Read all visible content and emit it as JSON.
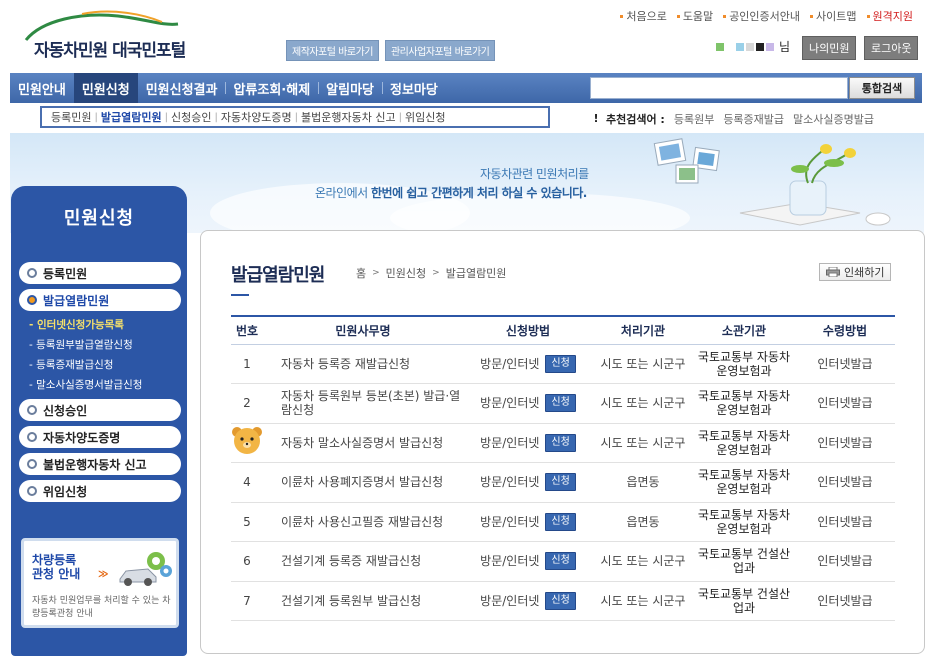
{
  "header": {
    "logo_text": "자동차민원 대국민포털",
    "portal_buttons": [
      "제작자포털 바로가기",
      "관리사업자포털 바로가기"
    ],
    "top_links": [
      "처음으로",
      "도움말",
      "공인인증서안내",
      "사이트맵",
      "원격지원"
    ],
    "user_suffix": "님",
    "my_button": "나의민원",
    "logout_button": "로그아웃"
  },
  "gnb": {
    "items": [
      "민원안내",
      "민원신청",
      "민원신청결과",
      "압류조회·해제",
      "알림마당",
      "정보마당"
    ],
    "active_index": 1,
    "search_value": "",
    "search_button": "통합검색"
  },
  "subnav": {
    "items": [
      "등록민원",
      "발급열람민원",
      "신청승인",
      "자동차양도증명",
      "불법운행자동차 신고",
      "위임신청"
    ],
    "active_index": 1
  },
  "recommend": {
    "label": "추천검색어 :",
    "links": [
      "등록원부",
      "등록증재발급",
      "말소사실증명발급"
    ]
  },
  "banner": {
    "line1": "자동차관련 민원처리를",
    "line2_prefix": "온라인에서 ",
    "line2_bold": "한번에 쉽고 간편하게 처리 하실 수 있습니다."
  },
  "side": {
    "title": "민원신청",
    "menu": [
      {
        "label": "등록민원",
        "active": false
      },
      {
        "label": "발급열람민원",
        "active": true
      }
    ],
    "sub_items": [
      "인터넷신청가능목록",
      "등록원부발급열람신청",
      "등록증재발급신청",
      "말소사실증명서발급신청"
    ],
    "sub_active_index": 0,
    "menu_rest": [
      "신청승인",
      "자동차양도증명",
      "불법운행자동차 신고",
      "위임신청"
    ],
    "box_title_1": "차량등록",
    "box_title_2": "관청 안내",
    "box_arrow": "≫",
    "box_desc": "자동차 민원업무를 처리할 수 있는 차량등록관청 안내"
  },
  "content": {
    "title": "발급열람민원",
    "breadcrumb": [
      "홈",
      "민원신청",
      "발급열람민원"
    ],
    "print_button": "인쇄하기",
    "table": {
      "headers": [
        "번호",
        "민원사무명",
        "신청방법",
        "처리기관",
        "소관기관",
        "수령방법"
      ],
      "apply_label": "신청",
      "rows": [
        {
          "no": "1",
          "name": "자동차 등록증 재발급신청",
          "method": "방문/인터넷",
          "proc": "시도 또는 시군구",
          "org": "국토교통부 자동차운영보험과",
          "recv": "인터넷발급"
        },
        {
          "no": "2",
          "name": "자동차 등록원부 등본(초본) 발급·열람신청",
          "method": "방문/인터넷",
          "proc": "시도 또는 시군구",
          "org": "국토교통부 자동차운영보험과",
          "recv": "인터넷발급"
        },
        {
          "no": "",
          "name": "자동차 말소사실증명서 발급신청",
          "method": "방문/인터넷",
          "proc": "시도 또는 시군구",
          "org": "국토교통부 자동차운영보험과",
          "recv": "인터넷발급"
        },
        {
          "no": "4",
          "name": "이륜차 사용폐지증명서 발급신청",
          "method": "방문/인터넷",
          "proc": "읍면동",
          "org": "국토교통부 자동차운영보험과",
          "recv": "인터넷발급"
        },
        {
          "no": "5",
          "name": "이륜차 사용신고필증 재발급신청",
          "method": "방문/인터넷",
          "proc": "읍면동",
          "org": "국토교통부 자동차운영보험과",
          "recv": "인터넷발급"
        },
        {
          "no": "6",
          "name": "건설기계 등록증 재발급신청",
          "method": "방문/인터넷",
          "proc": "시도 또는 시군구",
          "org": "국토교통부 건설산업과",
          "recv": "인터넷발급"
        },
        {
          "no": "7",
          "name": "건설기계 등록원부 발급신청",
          "method": "방문/인터넷",
          "proc": "시도 또는 시군구",
          "org": "국토교통부 건설산업과",
          "recv": "인터넷발급"
        }
      ]
    }
  },
  "colors": {
    "brand_blue": "#2c56a6",
    "gnb_active": "#27467c",
    "accent_orange": "#f08c2b",
    "remote_red": "#d21c1c"
  }
}
